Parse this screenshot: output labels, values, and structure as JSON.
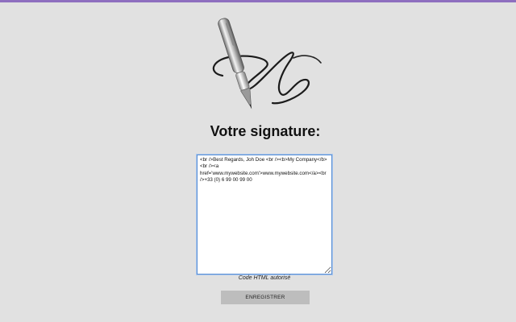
{
  "page": {
    "title": "Votre signature:",
    "signature_value": "<br />Best Regards, Joh Doe <br /><b>My Company</b><br /><a href='www.mywebsite.com'>www.mywebsite.com</a><br />+33 (0) 6 99 00 99 00",
    "hint": "Code HTML autorisé",
    "save_label": "ENREGISTRER"
  },
  "icons": {
    "logo": "pen-signature-icon"
  },
  "colors": {
    "background": "#e1e1e1",
    "top_bar": "#8e6fbf",
    "button": "#bdbdbd",
    "textarea_border": "#5b8fd2"
  }
}
